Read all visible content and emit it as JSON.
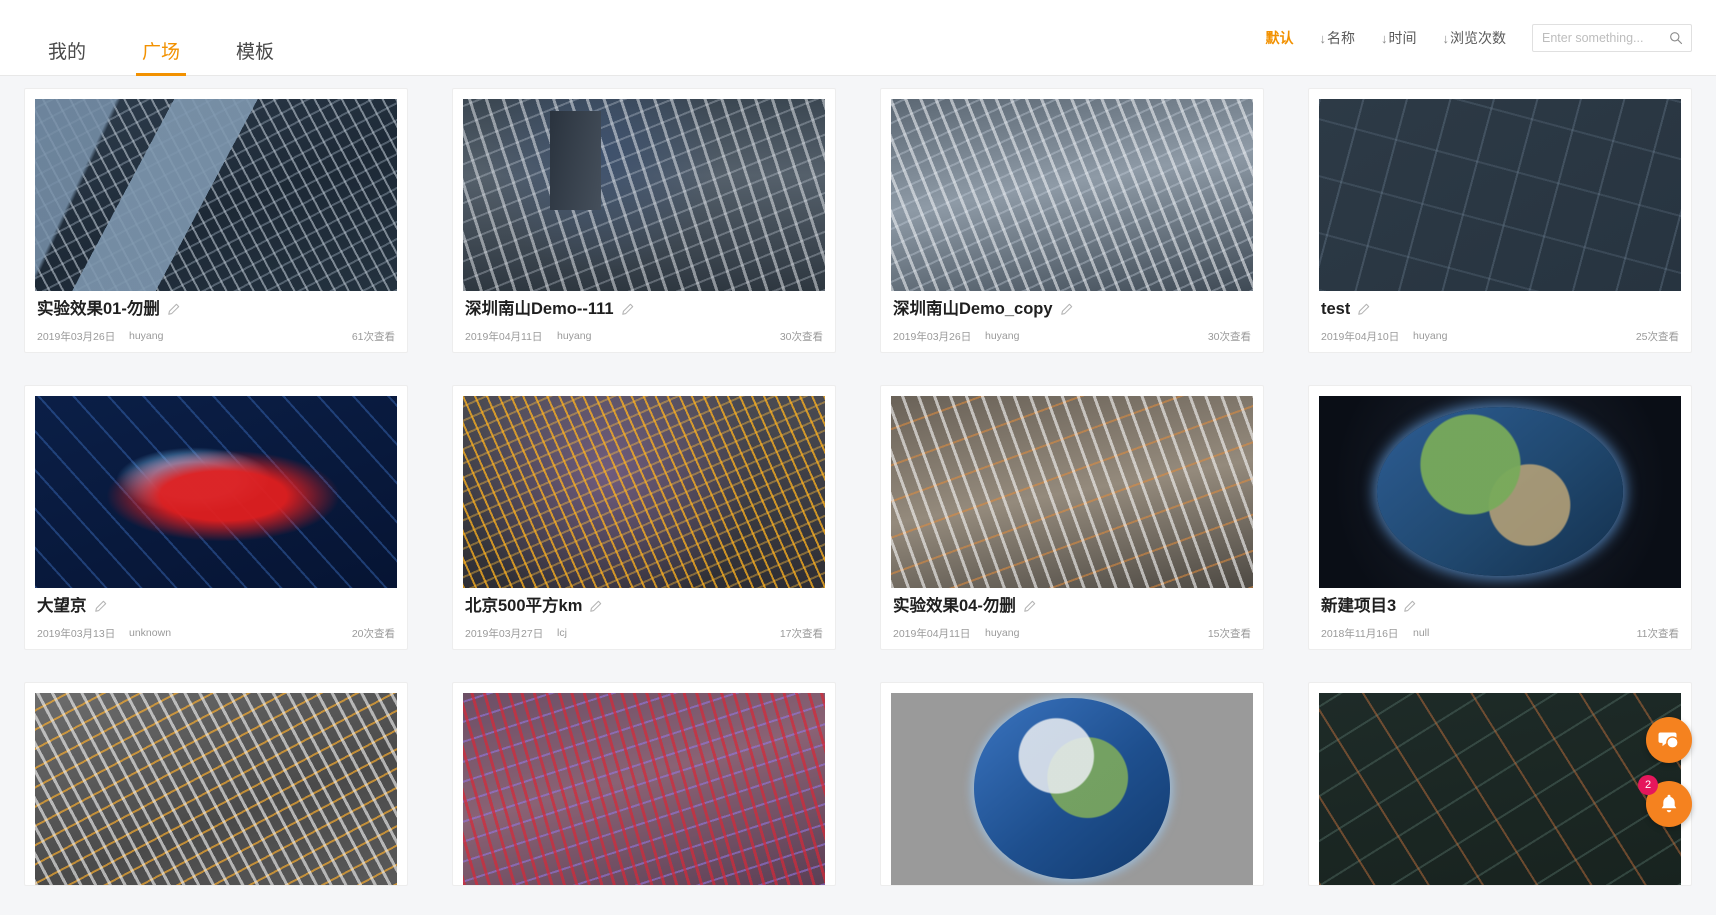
{
  "tabs": [
    {
      "label": "我的",
      "active": false
    },
    {
      "label": "广场",
      "active": true
    },
    {
      "label": "模板",
      "active": false
    }
  ],
  "sort": {
    "options": [
      {
        "label": "默认",
        "arrow": "",
        "active": true
      },
      {
        "label": "名称",
        "arrow": "↓",
        "active": false
      },
      {
        "label": "时间",
        "arrow": "↓",
        "active": false
      },
      {
        "label": "浏览次数",
        "arrow": "↓",
        "active": false
      }
    ]
  },
  "search": {
    "placeholder": "Enter something...",
    "value": "",
    "icon": "search-icon"
  },
  "colors": {
    "accent": "#f29100",
    "fab": "#f5821f",
    "badge": "#e5175c",
    "page_bg": "#f5f6f8",
    "card_bg": "#ffffff",
    "title": "#1f1f1f",
    "meta": "#9a9a9a"
  },
  "cards": [
    {
      "title": "实验效果01-勿删",
      "date": "2019年03月26日",
      "user": "huyang",
      "views": "61次查看",
      "edit_icon": "pencil-icon",
      "art": "t-city-aerial"
    },
    {
      "title": "深圳南山Demo--111",
      "date": "2019年04月11日",
      "user": "huyang",
      "views": "30次查看",
      "edit_icon": "pencil-icon",
      "art": "t-city-3d-dark"
    },
    {
      "title": "深圳南山Demo_copy",
      "date": "2019年03月26日",
      "user": "huyang",
      "views": "30次查看",
      "edit_icon": "pencil-icon",
      "art": "t-city-3d-grey"
    },
    {
      "title": "test",
      "date": "2019年04月10日",
      "user": "huyang",
      "views": "25次查看",
      "edit_icon": "pencil-icon",
      "art": "t-dark-roads"
    },
    {
      "title": "大望京",
      "date": "2019年03月13日",
      "user": "unknown",
      "views": "20次查看",
      "edit_icon": "pencil-icon",
      "art": "t-heat-red"
    },
    {
      "title": "北京500平方km",
      "date": "2019年03月27日",
      "user": "lcj",
      "views": "17次查看",
      "edit_icon": "pencil-icon",
      "art": "t-night-gold"
    },
    {
      "title": "实验效果04-勿删",
      "date": "2019年04月11日",
      "user": "huyang",
      "views": "15次查看",
      "edit_icon": "pencil-icon",
      "art": "t-city-orange"
    },
    {
      "title": "新建项目3",
      "date": "2018年11月16日",
      "user": "null",
      "views": "11次查看",
      "edit_icon": "pencil-icon",
      "art": "t-globe-dark"
    },
    {
      "title": "",
      "date": "",
      "user": "",
      "views": "",
      "edit_icon": "pencil-icon",
      "art": "t-city-grey-gold"
    },
    {
      "title": "",
      "date": "",
      "user": "",
      "views": "",
      "edit_icon": "pencil-icon",
      "art": "t-purple-red"
    },
    {
      "title": "",
      "date": "",
      "user": "",
      "views": "",
      "edit_icon": "pencil-icon",
      "art": "t-globe-grey"
    },
    {
      "title": "",
      "date": "",
      "user": "",
      "views": "",
      "edit_icon": "pencil-icon",
      "art": "t-satellite-dark"
    }
  ],
  "fab": {
    "chat": {
      "icon": "chat-bubbles-icon"
    },
    "bell": {
      "icon": "bell-icon",
      "badge": "2"
    }
  }
}
